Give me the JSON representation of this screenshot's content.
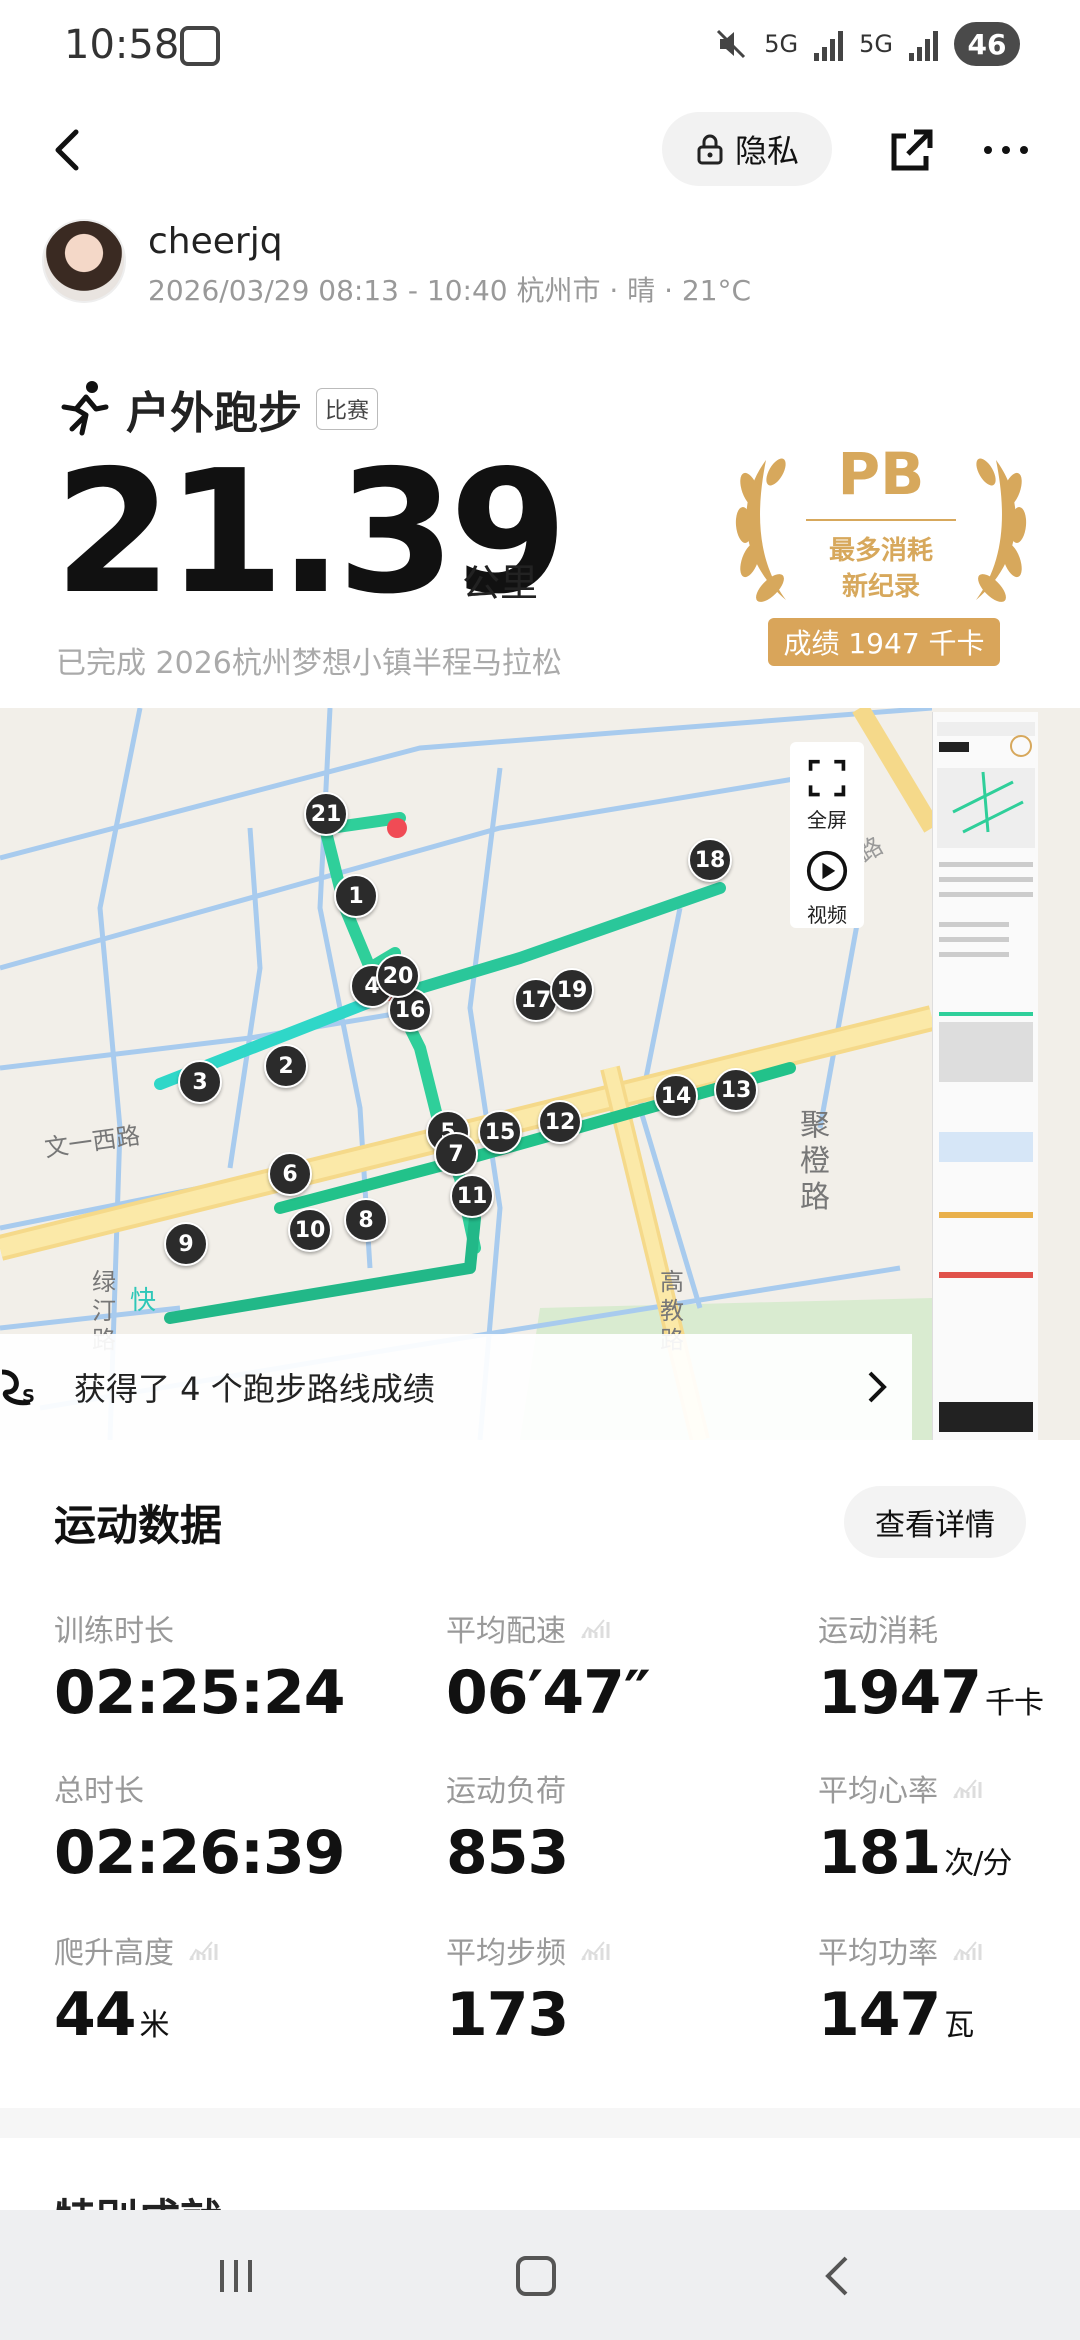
{
  "status": {
    "time": "10:58",
    "battery": "46",
    "net1": "5G",
    "net2": "5G"
  },
  "topbar": {
    "privacy_label": "隐私"
  },
  "user": {
    "name": "cheerjq",
    "meta": "2026/03/29 08:13 - 10:40 杭州市 · 晴 · 21°C"
  },
  "activity": {
    "title": "户外跑步",
    "tag": "比赛",
    "distance": "21.39",
    "unit": "公里",
    "race": "已完成 2026杭州梦想小镇半程马拉松"
  },
  "pb": {
    "label": "PB",
    "line1": "最多消耗",
    "line2": "新纪录",
    "badge": "成绩 1947 千卡"
  },
  "map": {
    "fullscreen": "全屏",
    "video": "视频",
    "achievement": "获得了 4 个跑步路线成绩",
    "legend_fast": "快",
    "road_labels": [
      "文一西路",
      "绿汀路",
      "高教路",
      "聚橙路",
      "余杭塘路"
    ],
    "markers": [
      "1",
      "2",
      "3",
      "4",
      "5",
      "6",
      "7",
      "8",
      "9",
      "10",
      "11",
      "12",
      "13",
      "14",
      "15",
      "16",
      "17",
      "18",
      "19",
      "20",
      "21"
    ]
  },
  "stats_section": {
    "title": "运动数据",
    "detail_button": "查看详情",
    "items": [
      {
        "label": "训练时长",
        "value": "02:25:24",
        "unit": ""
      },
      {
        "label": "平均配速",
        "value": "06′47″",
        "unit": ""
      },
      {
        "label": "运动消耗",
        "value": "1947",
        "unit": "千卡"
      },
      {
        "label": "总时长",
        "value": "02:26:39",
        "unit": ""
      },
      {
        "label": "运动负荷",
        "value": "853",
        "unit": ""
      },
      {
        "label": "平均心率",
        "value": "181",
        "unit": "次/分"
      },
      {
        "label": "爬升高度",
        "value": "44",
        "unit": "米"
      },
      {
        "label": "平均步频",
        "value": "173",
        "unit": ""
      },
      {
        "label": "平均功率",
        "value": "147",
        "unit": "瓦"
      }
    ]
  },
  "next_section": {
    "title": "特别成就"
  },
  "colors": {
    "route_fast": "#2fd7c8",
    "route_slow": "#e0524a",
    "pb_gold": "#d7a85c"
  }
}
